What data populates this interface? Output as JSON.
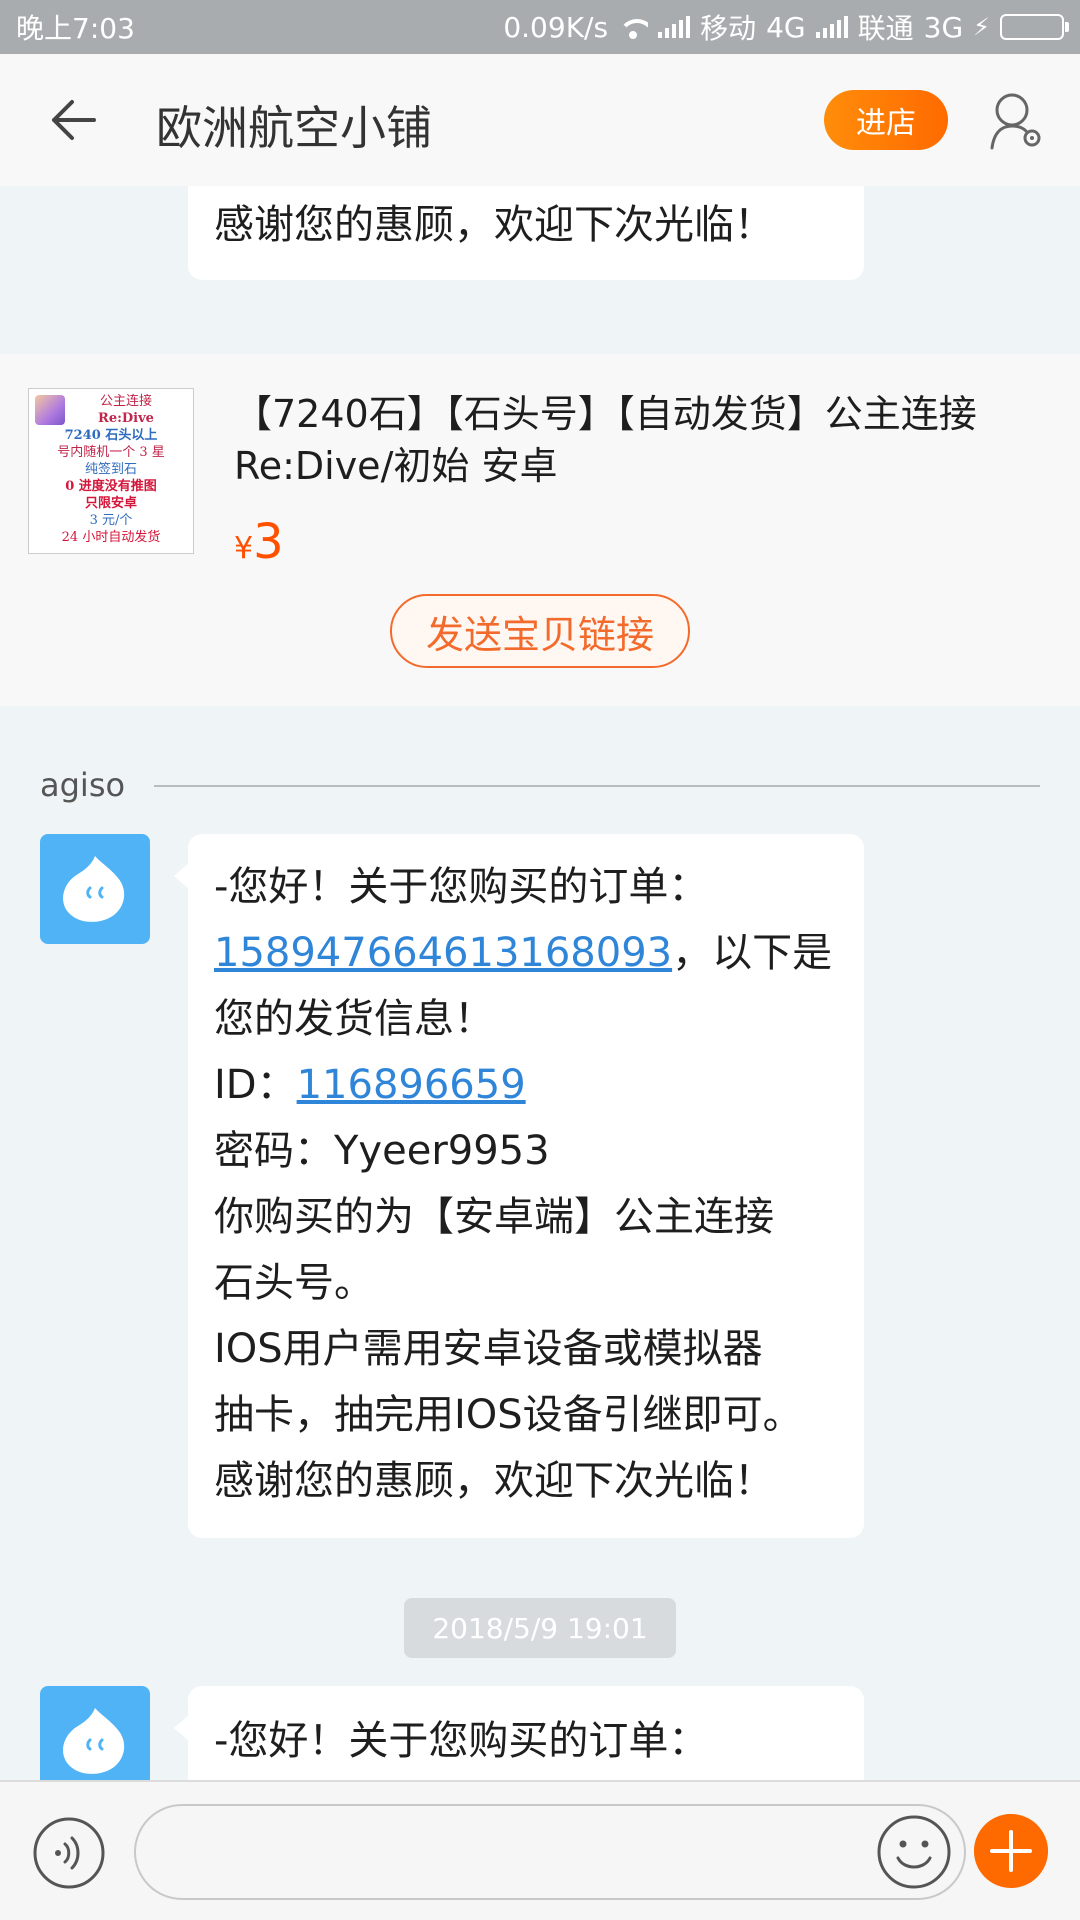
{
  "status_bar": {
    "time": "晚上7:03",
    "speed": "0.09K/s",
    "carrier1": "移动",
    "network1": "4G",
    "carrier2": "联通",
    "network2": "3G",
    "battery_color": "#43d000"
  },
  "header": {
    "title": "欧洲航空小铺",
    "enter_shop_label": "进店",
    "accent_color": "#ff6a00"
  },
  "messages": {
    "top_partial": "感谢您的惠顾，欢迎下次光临！"
  },
  "product": {
    "thumb_lines": [
      "公主连接",
      "Re:Dive",
      "7240 石头以上",
      "号内随机一个 3 星",
      "纯签到石",
      "0 进度没有推图",
      "只限安卓",
      "3 元/个",
      "24 小时自动发货"
    ],
    "name_line1": "【7240石】【石头号】【自动发货】公主连接",
    "name_line2": "Re:Dive/初始 安卓",
    "price_symbol": "¥",
    "price": "3",
    "send_link_label": "发送宝贝链接"
  },
  "sender": {
    "name": "agiso"
  },
  "main_message": {
    "l1": "-您好！关于您购买的订单：",
    "order_id": "158947664613168093",
    "l2_suffix": "，以下是",
    "l3": "您的发货信息！",
    "id_label": "ID：",
    "id_value": "116896659",
    "password": "密码：Yyeer9953",
    "l6": "你购买的为【安卓端】公主连接",
    "l7": "石头号。",
    "l8": "IOS用户需用安卓设备或模拟器",
    "l9": "抽卡，抽完用IOS设备引继即可。",
    "l10": "感谢您的惠顾，欢迎下次光临！"
  },
  "timestamp": "2018/5/9 19:01",
  "last_message": {
    "l1": "-您好！关于您购买的订单："
  },
  "input_bar": {
    "placeholder": "",
    "voice_icon": "voice-icon",
    "emoji_icon": "emoji-icon",
    "more_icon": "plus-icon"
  }
}
